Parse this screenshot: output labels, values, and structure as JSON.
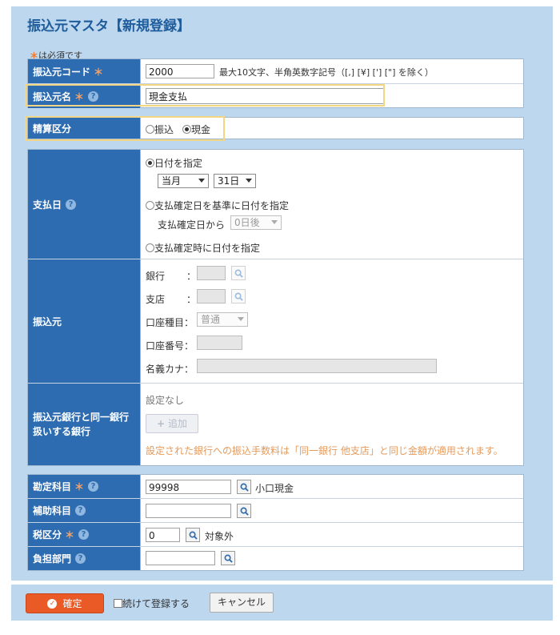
{
  "title": "振込元マスタ【新規登録】",
  "required_note": "は必須です",
  "required_mark": "＊",
  "help_glyph": "?",
  "section1": {
    "code": {
      "label": "振込元コード",
      "value": "2000",
      "hint": "最大10文字、半角英数字記号（[,] [¥] ['] [\"] を除く）"
    },
    "name": {
      "label": "振込元名",
      "value": "現金支払"
    }
  },
  "settlement": {
    "label": "精算区分",
    "options": [
      "振込",
      "現金"
    ],
    "selected": "現金"
  },
  "payment_date": {
    "label": "支払日",
    "option1": "日付を指定",
    "month_select": "当月",
    "day_select": "31日",
    "option2": "支払確定日を基準に日付を指定",
    "from_label": "支払確定日から",
    "days_after_select": "0日後",
    "option3": "支払確定時に日付を指定"
  },
  "source": {
    "label": "振込元",
    "bank_label": "銀行",
    "branch_label": "支店",
    "colon": "：",
    "account_type_label": "口座種目：",
    "account_type_select": "普通",
    "account_number_label": "口座番号：",
    "account_name_label": "名義カナ："
  },
  "same_bank": {
    "label_line1": "振込元銀行と同一銀行",
    "label_line2": "扱いする銀行",
    "none_text": "設定なし",
    "add_button": "追加",
    "note": "設定された銀行への振込手数料は「同一銀行 他支店」と同じ金額が適用されます。"
  },
  "accounts": {
    "account": {
      "label": "勘定科目",
      "value": "99998",
      "desc": "小口現金"
    },
    "sub_account": {
      "label": "補助科目",
      "value": ""
    },
    "tax": {
      "label": "税区分",
      "value": "0",
      "desc": "対象外"
    },
    "department": {
      "label": "負担部門",
      "value": ""
    }
  },
  "footer": {
    "confirm": "確定",
    "continue": "続けて登録する",
    "cancel": "キャンセル"
  },
  "colors": {
    "header_blue": "#2d6cb0",
    "panel_bg": "#bcd7ee",
    "confirm_orange": "#ea5a26",
    "highlight_yellow": "#f2d683"
  }
}
